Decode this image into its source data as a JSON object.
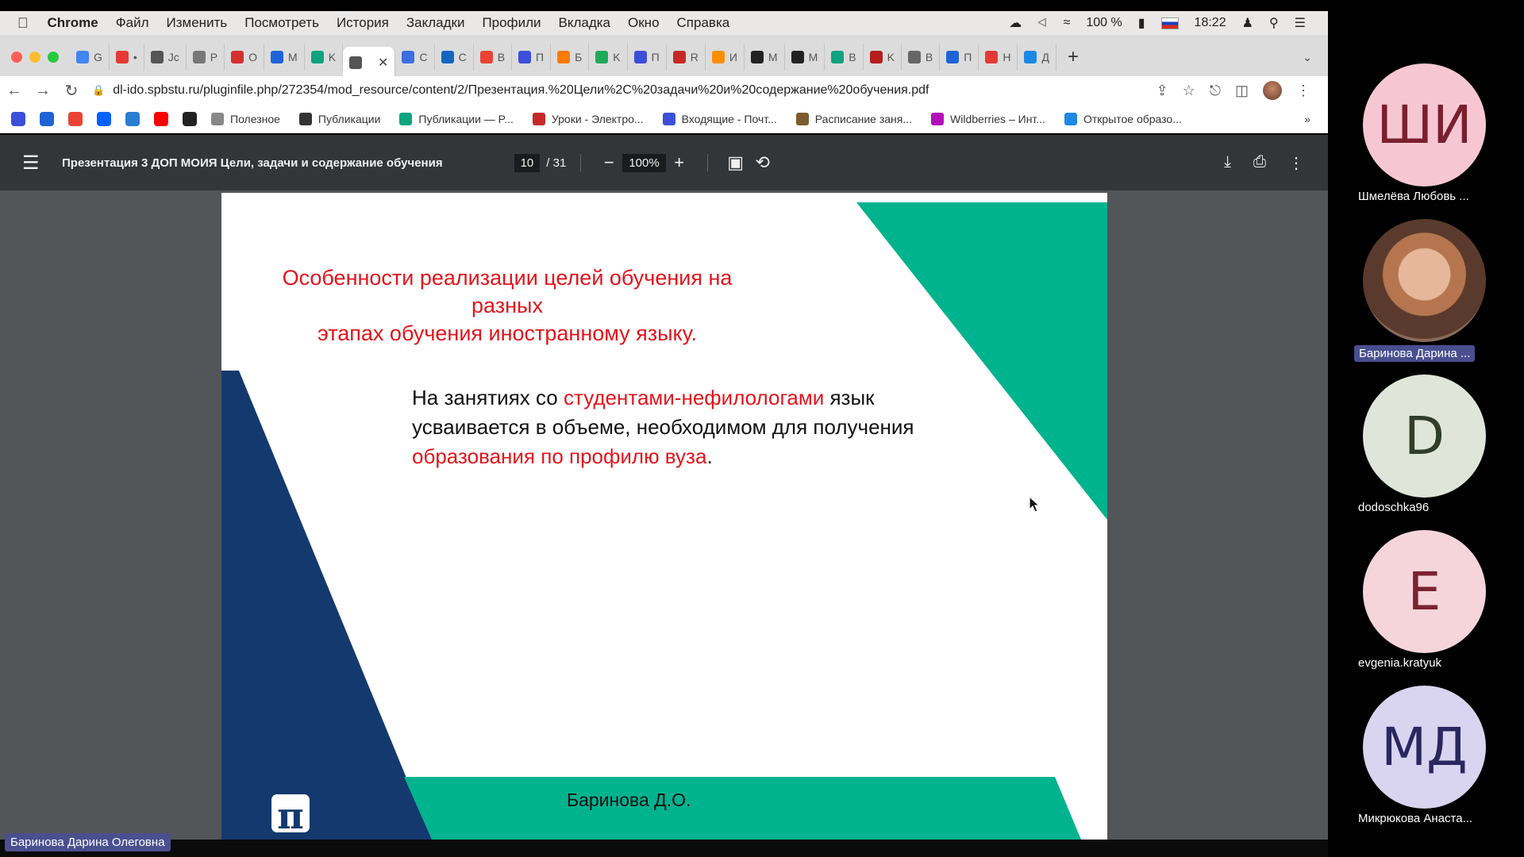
{
  "menubar": {
    "app": "Chrome",
    "items": [
      "Файл",
      "Изменить",
      "Посмотреть",
      "История",
      "Закладки",
      "Профили",
      "Вкладка",
      "Окно",
      "Справка"
    ],
    "battery": "100 %",
    "time": "18:22"
  },
  "tabs": [
    {
      "label": "G",
      "color": "#4285f4"
    },
    {
      "label": "•",
      "color": "#e53935"
    },
    {
      "label": "Jc",
      "color": "#555555"
    },
    {
      "label": "P",
      "color": "#777777"
    },
    {
      "label": "O",
      "color": "#d32f2f"
    },
    {
      "label": "M",
      "color": "#1e63d6"
    },
    {
      "label": "K",
      "color": "#10a37f"
    },
    {
      "label": "",
      "color": "#555555",
      "active": true
    },
    {
      "label": "C",
      "color": "#3b6fe0"
    },
    {
      "label": "C",
      "color": "#1565c0"
    },
    {
      "label": "B",
      "color": "#ea4335"
    },
    {
      "label": "П",
      "color": "#3b4fd8"
    },
    {
      "label": "Б",
      "color": "#ff7b00"
    },
    {
      "label": "K",
      "color": "#1faa59"
    },
    {
      "label": "П",
      "color": "#3b4fd8"
    },
    {
      "label": "R",
      "color": "#c62828"
    },
    {
      "label": "И",
      "color": "#ff8f00"
    },
    {
      "label": "M",
      "color": "#222222"
    },
    {
      "label": "M",
      "color": "#222222"
    },
    {
      "label": "B",
      "color": "#10a37f"
    },
    {
      "label": "K",
      "color": "#b71c1c"
    },
    {
      "label": "B",
      "color": "#666666"
    },
    {
      "label": "П",
      "color": "#1e63d6"
    },
    {
      "label": "H",
      "color": "#e53935"
    },
    {
      "label": "Д",
      "color": "#1e88e5"
    }
  ],
  "address": {
    "url": "dl-ido.spbstu.ru/pluginfile.php/272354/mod_resource/content/2/Презентация.%20Цели%2C%20задачи%20и%20содержание%20обучения.pdf"
  },
  "bookmarks": [
    {
      "label": "Полезное",
      "color": "#888888"
    },
    {
      "label": "Публикации",
      "color": "#333333"
    },
    {
      "label": "Публикации — P...",
      "color": "#10a37f"
    },
    {
      "label": "Уроки - Электро...",
      "color": "#c62828"
    },
    {
      "label": "Входящие - Почт...",
      "color": "#3b4fd8"
    },
    {
      "label": "Расписание заня...",
      "color": "#7a5b2e"
    },
    {
      "label": "Wildberries – Инт...",
      "color": "#b20fb8"
    },
    {
      "label": "Открытое образо...",
      "color": "#1e88e5"
    }
  ],
  "pdf": {
    "title": "Презентация 3 ДОП МОИЯ Цели, задачи и содержание обучения",
    "page": "10",
    "total": "/ 31",
    "zoom": "100%"
  },
  "slide": {
    "heading_line1": "Особенности реализации целей обучения на разных",
    "heading_line2": "этапах обучения иностранному языку.",
    "body_part1": "На занятиях со ",
    "body_red1": "студентами-нефилологами",
    "body_part2": " язык усваивается в объеме, необходимом для получения ",
    "body_red2": "образования по профилю вуза",
    "body_part3": ".",
    "author": "Баринова Д.О.",
    "logo": "π",
    "colors": {
      "teal": "#00b38f",
      "navy": "#14396e",
      "red": "#e3141c"
    }
  },
  "speaker_label": "Баринова Дарина Олеговна",
  "participants": [
    {
      "initials": "ШИ",
      "name": "Шмелёва Любовь ...",
      "bg": "#f6c7d2",
      "fg": "#7a1f2e"
    },
    {
      "initials": "",
      "name": "Баринова Дарина ...",
      "photo": true,
      "highlight": true
    },
    {
      "initials": "D",
      "name": "dodoschka96",
      "bg": "#dfe5d8",
      "fg": "#2f3d2a"
    },
    {
      "initials": "E",
      "name": "evgenia.kratyuk",
      "bg": "#f6d5da",
      "fg": "#7a2230"
    },
    {
      "initials": "МД",
      "name": "Микрюкова Анаста...",
      "bg": "#d9d4ef",
      "fg": "#2b2660"
    }
  ]
}
